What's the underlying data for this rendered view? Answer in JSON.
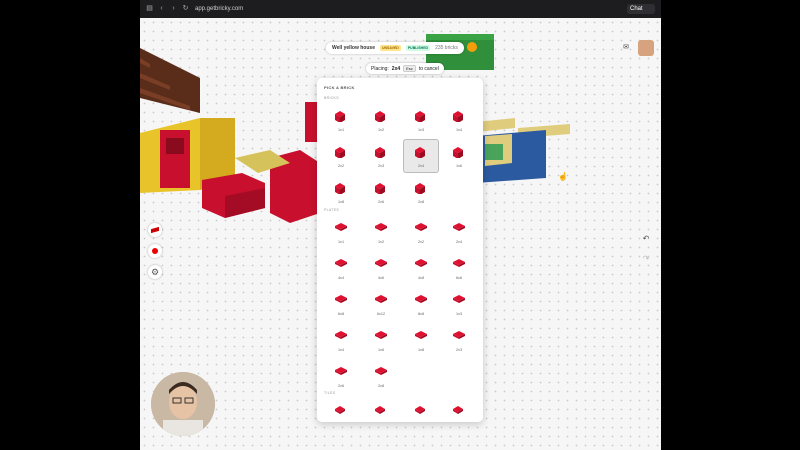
{
  "browser": {
    "url": "app.getbricky.com",
    "chat_label": "Chat"
  },
  "header": {
    "title": "Well yellow house",
    "badge_unsaved": "UNSAVED",
    "badge_published": "PUBLISHED",
    "brick_count": "235 bricks"
  },
  "placing": {
    "prefix": "Placing:",
    "item": "2x4",
    "key": "Esc",
    "suffix": "to cancel"
  },
  "panel": {
    "title": "PICK A BRICK",
    "sections": [
      {
        "name": "BRICKS",
        "items": [
          "1x1",
          "1x2",
          "1x3",
          "1x4",
          "2x2",
          "2x3",
          "2x4",
          "1x6",
          "1x8",
          "2x6",
          "2x8"
        ]
      },
      {
        "name": "PLATES",
        "items": [
          "1x1",
          "1x2",
          "2x2",
          "2x4",
          "4x4",
          "4x6",
          "4x8",
          "6x6",
          "6x8",
          "6x12",
          "8x8",
          "1x3",
          "1x4",
          "1x6",
          "1x8",
          "2x3",
          "2x6",
          "2x8"
        ]
      },
      {
        "name": "TILES",
        "items": [
          "",
          "",
          "",
          ""
        ]
      }
    ],
    "selected": "2x4"
  },
  "colors": {
    "brick": "#c8102e",
    "accent": "#f59e0b"
  },
  "icons": [
    "sidebar-icon",
    "back-icon",
    "forward-icon",
    "reload-icon",
    "chat-icon",
    "message-icon",
    "gear-icon",
    "undo-icon",
    "redo-icon"
  ]
}
